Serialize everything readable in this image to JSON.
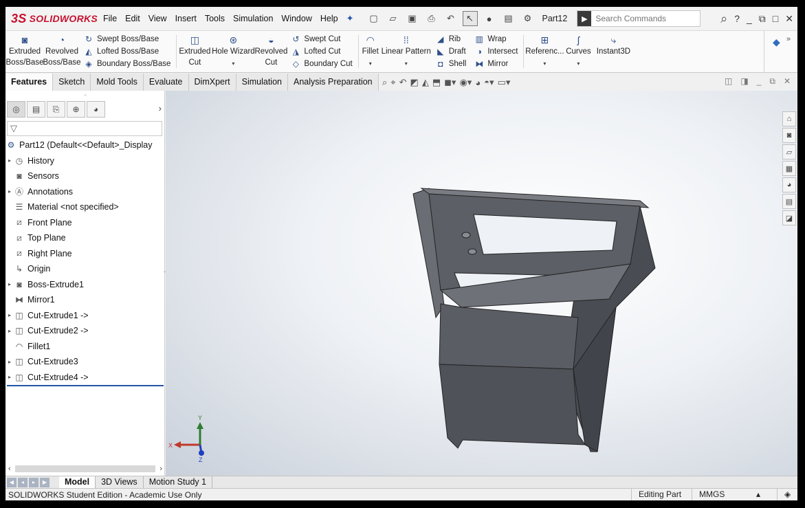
{
  "app": {
    "logo_ds": "3S",
    "logo_text": "SOLIDWORKS",
    "menus": [
      "File",
      "Edit",
      "View",
      "Insert",
      "Tools",
      "Simulation",
      "Window",
      "Help"
    ],
    "doc_name": "Part12",
    "search_placeholder": "Search Commands"
  },
  "ribbon": {
    "extruded_boss": "Extruded Boss/Base",
    "revolved_boss": "Revolved Boss/Base",
    "swept_boss": "Swept Boss/Base",
    "lofted_boss": "Lofted Boss/Base",
    "boundary_boss": "Boundary Boss/Base",
    "extruded_cut": "Extruded Cut",
    "hole_wizard": "Hole Wizard",
    "revolved_cut": "Revolved Cut",
    "swept_cut": "Swept Cut",
    "lofted_cut": "Lofted Cut",
    "boundary_cut": "Boundary Cut",
    "fillet": "Fillet",
    "linear_pattern": "Linear Pattern",
    "rib": "Rib",
    "draft": "Draft",
    "shell": "Shell",
    "wrap": "Wrap",
    "intersect": "Intersect",
    "mirror": "Mirror",
    "reference": "Referenc...",
    "curves": "Curves",
    "instant3d": "Instant3D"
  },
  "tabs": [
    "Features",
    "Sketch",
    "Mold Tools",
    "Evaluate",
    "DimXpert",
    "Simulation",
    "Analysis Preparation"
  ],
  "tree": {
    "root": "Part12  (Default<<Default>_Display",
    "items": [
      {
        "label": "History",
        "icon": "history-icon",
        "expandable": true
      },
      {
        "label": "Sensors",
        "icon": "sensors-icon",
        "expandable": false
      },
      {
        "label": "Annotations",
        "icon": "annotations-icon",
        "expandable": true
      },
      {
        "label": "Material <not specified>",
        "icon": "material-icon",
        "expandable": false
      },
      {
        "label": "Front Plane",
        "icon": "plane-icon",
        "expandable": false
      },
      {
        "label": "Top Plane",
        "icon": "plane-icon",
        "expandable": false
      },
      {
        "label": "Right Plane",
        "icon": "plane-icon",
        "expandable": false
      },
      {
        "label": "Origin",
        "icon": "origin-icon",
        "expandable": false
      },
      {
        "label": "Boss-Extrude1",
        "icon": "boss-extrude-icon",
        "expandable": true
      },
      {
        "label": "Mirror1",
        "icon": "mirror-icon",
        "expandable": false
      },
      {
        "label": "Cut-Extrude1 ->",
        "icon": "cut-extrude-icon",
        "expandable": true
      },
      {
        "label": "Cut-Extrude2 ->",
        "icon": "cut-extrude-icon",
        "expandable": true
      },
      {
        "label": "Fillet1",
        "icon": "fillet-icon",
        "expandable": false
      },
      {
        "label": "Cut-Extrude3",
        "icon": "cut-extrude-icon",
        "expandable": true
      },
      {
        "label": "Cut-Extrude4 ->",
        "icon": "cut-extrude-icon",
        "expandable": true
      }
    ]
  },
  "triad": {
    "x": "X",
    "y": "Y",
    "z": "Z"
  },
  "bottom_tabs": [
    "Model",
    "3D Views",
    "Motion Study 1"
  ],
  "status": {
    "text": "SOLIDWORKS Student Edition - Academic Use Only",
    "mode": "Editing Part",
    "units": "MMGS"
  },
  "colors": {
    "brand": "#c8102e",
    "accent": "#2155a5",
    "model_face": "#5d5f66"
  }
}
